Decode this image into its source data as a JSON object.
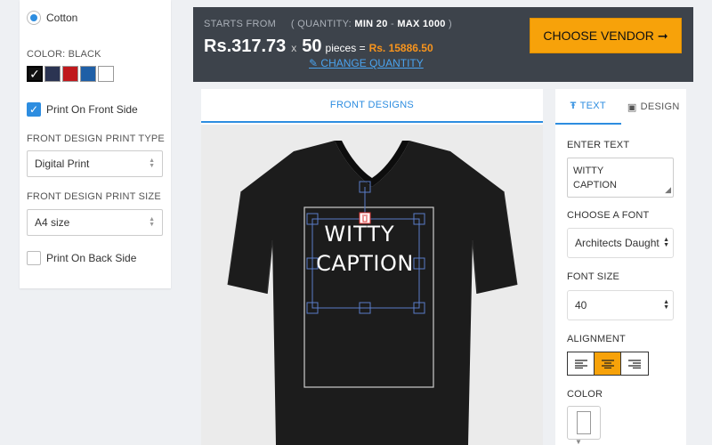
{
  "left": {
    "material_option": "Cotton",
    "color_label": "COLOR: BLACK",
    "swatch_colors": [
      "#111111",
      "#2b3452",
      "#c0191d",
      "#1f5fa6",
      "#ffffff"
    ],
    "selected_swatch": 0,
    "front_checkbox_label": "Print On Front Side",
    "front_checked": true,
    "print_type_label": "FRONT DESIGN PRINT TYPE",
    "print_type_value": "Digital Print",
    "print_size_label": "FRONT DESIGN PRINT SIZE",
    "print_size_value": "A4 size",
    "back_checkbox_label": "Print On Back Side",
    "back_checked": false
  },
  "topbar": {
    "starts_from": "STARTS FROM",
    "quantity_prefix": "( QUANTITY:",
    "min": "MIN 20",
    "dash": "-",
    "max": "MAX 1000",
    "quantity_suffix": ")",
    "price": "Rs.317.73",
    "times": "x",
    "quantity": "50",
    "pieces": "pieces =",
    "total": "Rs. 15886.50",
    "change_quantity": "CHANGE QUANTITY",
    "vendor_button": "CHOOSE VENDOR"
  },
  "design": {
    "tab_label": "FRONT DESIGNS",
    "caption_line1": "WITTY",
    "caption_line2": "CAPTION",
    "shirt_color": "#1c1c1c"
  },
  "tools": {
    "tab_text": "TEXT",
    "tab_design": "DESIGN",
    "enter_text_label": "ENTER TEXT",
    "text_line1": "WITTY",
    "text_line2": "CAPTION",
    "font_label": "CHOOSE A FONT",
    "font_value": "Architects Daught",
    "size_label": "FONT SIZE",
    "size_value": "40",
    "alignment_label": "ALIGNMENT",
    "alignment_active": "center",
    "color_label": "COLOR"
  },
  "colors": {
    "accent_blue": "#2d8de0",
    "accent_orange": "#f7a20a",
    "topbar_bg": "#3d434b",
    "total_orange": "#f7941d"
  }
}
